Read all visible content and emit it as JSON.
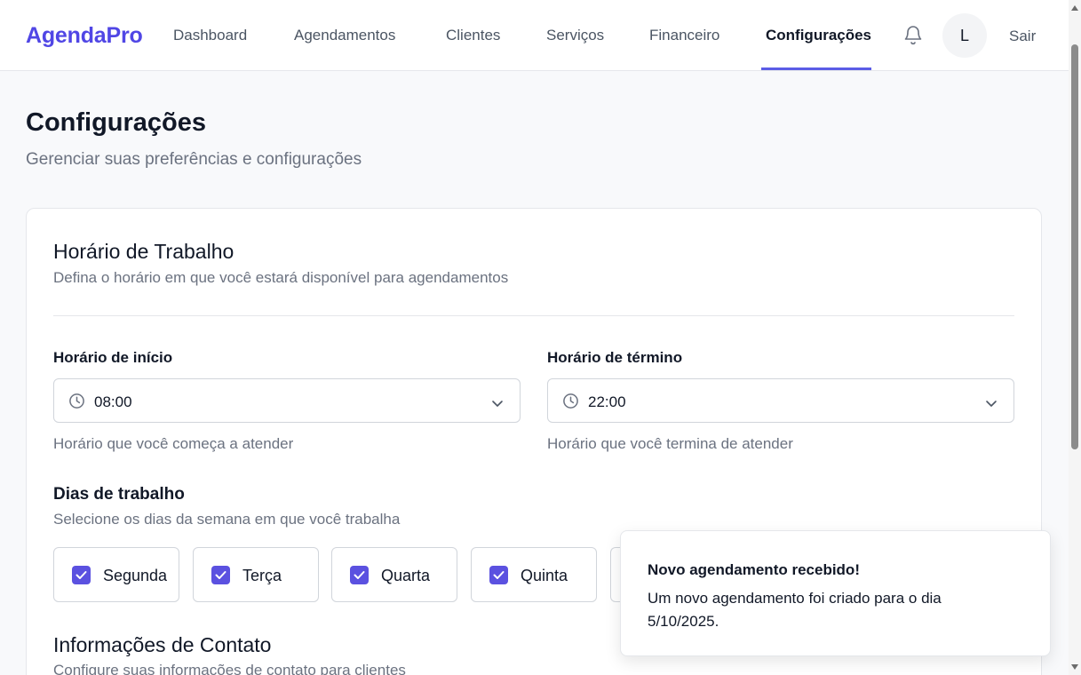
{
  "app": {
    "logo": "AgendaPro"
  },
  "nav": {
    "items": [
      {
        "label": "Dashboard"
      },
      {
        "label": "Agendamentos"
      },
      {
        "label": "Clientes"
      },
      {
        "label": "Serviços"
      },
      {
        "label": "Financeiro"
      },
      {
        "label": "Configurações"
      }
    ],
    "active_index": 5,
    "avatar_initial": "L",
    "logout_label": "Sair"
  },
  "page": {
    "title": "Configurações",
    "subtitle": "Gerenciar suas preferências e configurações"
  },
  "work_hours": {
    "title": "Horário de Trabalho",
    "description": "Defina o horário em que você estará disponível para agendamentos",
    "start": {
      "label": "Horário de início",
      "value": "08:00",
      "hint": "Horário que você começa a atender"
    },
    "end": {
      "label": "Horário de término",
      "value": "22:00",
      "hint": "Horário que você termina de atender"
    },
    "days": {
      "label": "Dias de trabalho",
      "description": "Selecione os dias da semana em que você trabalha",
      "items": [
        {
          "name": "Segunda",
          "checked": true
        },
        {
          "name": "Terça",
          "checked": true
        },
        {
          "name": "Quarta",
          "checked": true
        },
        {
          "name": "Quinta",
          "checked": true
        }
      ]
    }
  },
  "contact": {
    "title": "Informações de Contato",
    "description": "Configure suas informações de contato para clientes"
  },
  "toast": {
    "title": "Novo agendamento recebido!",
    "body": "Um novo agendamento foi criado para o dia 5/10/2025."
  },
  "colors": {
    "brand": "#5046e5",
    "accent": "#5b51e0",
    "muted_text": "#6b7280",
    "border": "#e5e7eb"
  }
}
